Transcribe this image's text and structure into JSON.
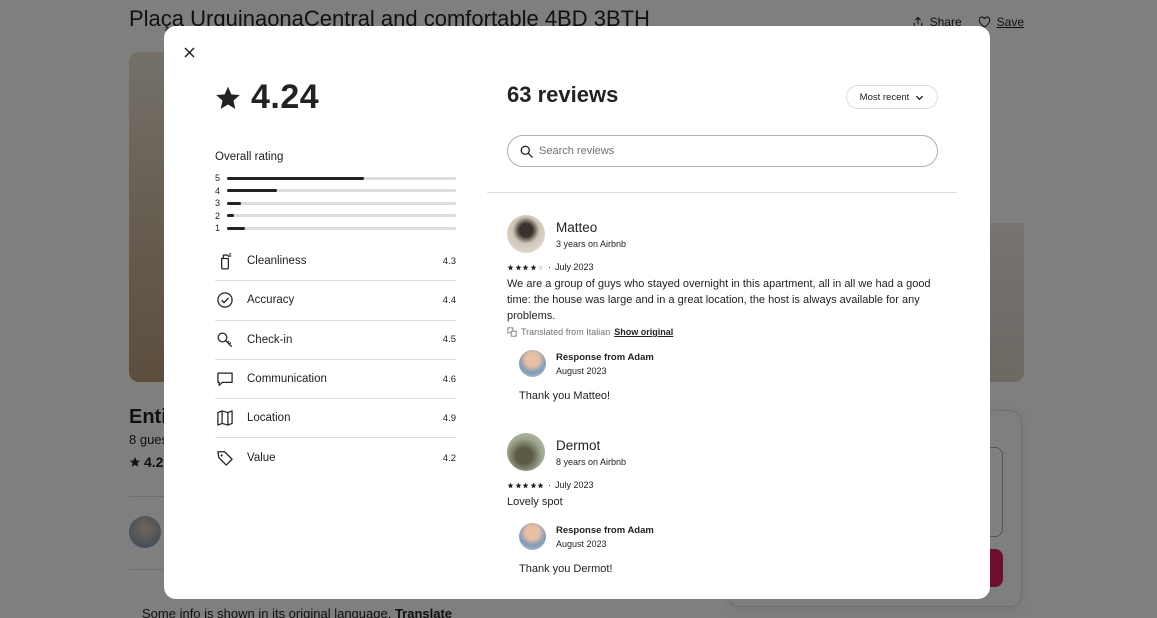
{
  "listing": {
    "title": "Plaça UrquinaonaCentral and comfortable 4BD 3BTH",
    "share_label": "Share",
    "save_label": "Save",
    "entire_heading": "Entir",
    "guests_text": "8 gues",
    "rating_short": "4.2",
    "bottom_note": "Some info is shown in its original language.",
    "translate_label": "Translate"
  },
  "modal": {
    "score": "4.24",
    "overall_label": "Overall rating",
    "distribution": [
      {
        "stars": "5",
        "fraction": 0.6
      },
      {
        "stars": "4",
        "fraction": 0.22
      },
      {
        "stars": "3",
        "fraction": 0.06
      },
      {
        "stars": "2",
        "fraction": 0.03
      },
      {
        "stars": "1",
        "fraction": 0.08
      }
    ],
    "categories": [
      {
        "name": "Cleanliness",
        "value": "4.3",
        "icon": "spray-bottle-icon"
      },
      {
        "name": "Accuracy",
        "value": "4.4",
        "icon": "check-circle-icon"
      },
      {
        "name": "Check-in",
        "value": "4.5",
        "icon": "key-icon"
      },
      {
        "name": "Communication",
        "value": "4.6",
        "icon": "chat-bubble-icon"
      },
      {
        "name": "Location",
        "value": "4.9",
        "icon": "map-icon"
      },
      {
        "name": "Value",
        "value": "4.2",
        "icon": "tag-icon"
      }
    ],
    "reviews_title": "63 reviews",
    "sort_label": "Most recent",
    "search_placeholder": "Search reviews",
    "reviews": [
      {
        "name": "Matteo",
        "tenure": "3 years on Airbnb",
        "stars": 4,
        "date": "July 2023",
        "text": "We are a group of guys who stayed overnight in this apartment, all in all we had a good time: the house was large and in a great location, the host is always available for any problems.",
        "translated_note": "Translated from Italian",
        "show_original": "Show original",
        "response_from": "Response from Adam",
        "response_date": "August 2023",
        "response_text": "Thank you Matteo!"
      },
      {
        "name": "Dermot",
        "tenure": "8 years on Airbnb",
        "stars": 5,
        "date": "July 2023",
        "text": "Lovely spot",
        "response_from": "Response from Adam",
        "response_date": "August 2023",
        "response_text": "Thank you Dermot!"
      }
    ]
  }
}
